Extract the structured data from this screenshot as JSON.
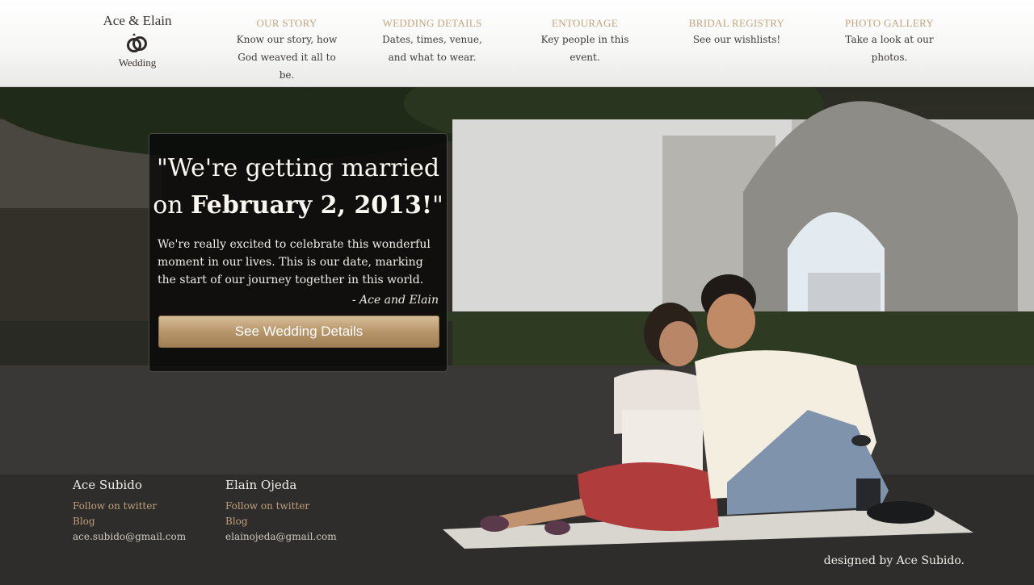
{
  "brand": {
    "title": "Ace & Elain",
    "subtitle": "Wedding",
    "rings_icon": "wedding-rings-icon"
  },
  "nav": [
    {
      "title": "OUR STORY",
      "desc": "Know our story, how God weaved it all to be."
    },
    {
      "title": "WEDDING DETAILS",
      "desc": "Dates, times, venue, and what to wear."
    },
    {
      "title": "ENTOURAGE",
      "desc": "Key people in this event."
    },
    {
      "title": "BRIDAL REGISTRY",
      "desc": "See our wishlists!"
    },
    {
      "title": "PHOTO GALLERY",
      "desc": "Take a look at our photos."
    }
  ],
  "hero": {
    "quote_line1": "\"We're getting married",
    "quote_prefix": "on ",
    "quote_date": "February 2, 2013!",
    "quote_suffix": "\"",
    "body": "We're really excited to celebrate this wonderful moment in our lives. This is our date, marking the start of our journey together in this world.",
    "signature": "- Ace and Elain",
    "cta_label": "See Wedding Details"
  },
  "contacts": [
    {
      "name": "Ace Subido",
      "twitter": "Follow on twitter",
      "blog": "Blog",
      "email": "ace.subido@gmail.com"
    },
    {
      "name": "Elain Ojeda",
      "twitter": "Follow on twitter",
      "blog": "Blog",
      "email": "elainojeda@gmail.com"
    }
  ],
  "footer": {
    "credit": "designed by Ace Subido."
  },
  "colors": {
    "nav_title": "#c4a57d",
    "link": "#c0a07a",
    "cta_top": "#d6bd98",
    "cta_bottom": "#a17f56"
  }
}
